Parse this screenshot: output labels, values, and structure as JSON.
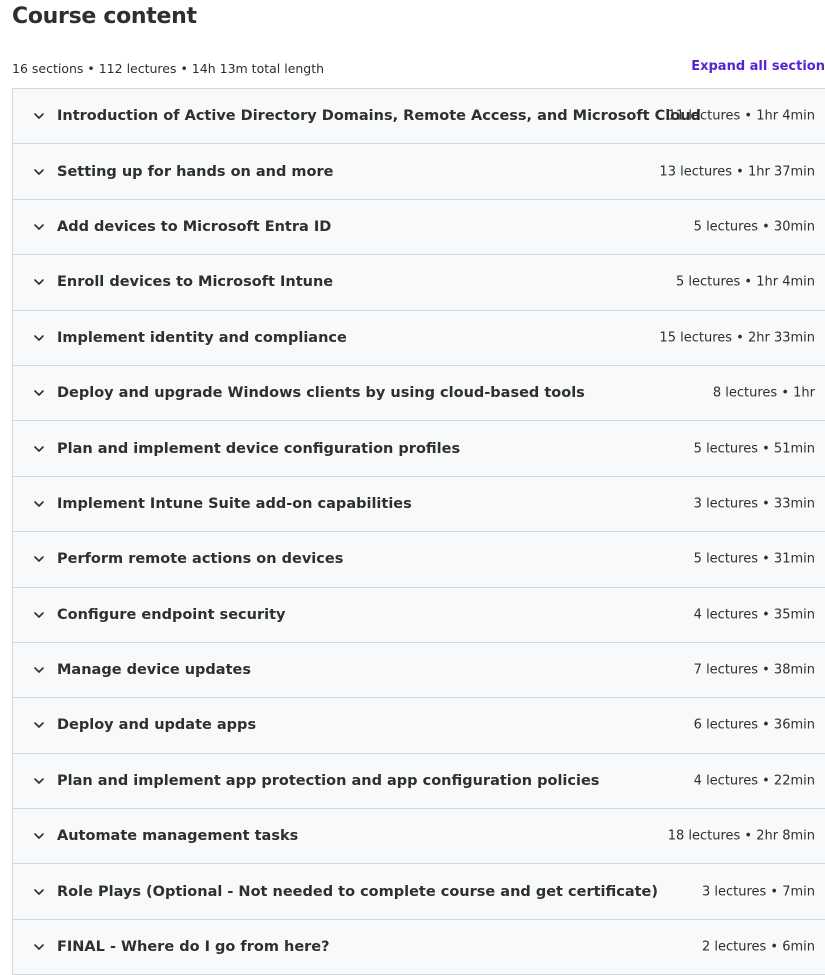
{
  "header": {
    "title": "Course content",
    "summary": "16 sections • 112 lectures • 14h 13m total length",
    "expand_all_label": "Expand all section"
  },
  "icons": {
    "section_toggle": "chevron-down-icon"
  },
  "colors": {
    "accent": "#5624d0",
    "section_bg": "#f7f9fa",
    "border": "#d1d7dc",
    "text": "#2d2f31"
  },
  "sections": [
    {
      "title": "Introduction of Active Directory Domains, Remote Access, and Microsoft Cloud",
      "meta": "11 lectures • 1hr 4min"
    },
    {
      "title": "Setting up for hands on and more",
      "meta": "13 lectures • 1hr 37min"
    },
    {
      "title": "Add devices to Microsoft Entra ID",
      "meta": "5 lectures • 30min"
    },
    {
      "title": "Enroll devices to Microsoft Intune",
      "meta": "5 lectures • 1hr 4min"
    },
    {
      "title": "Implement identity and compliance",
      "meta": "15 lectures • 2hr 33min"
    },
    {
      "title": "Deploy and upgrade Windows clients by using cloud-based tools",
      "meta": "8 lectures • 1hr"
    },
    {
      "title": "Plan and implement device configuration profiles",
      "meta": "5 lectures • 51min"
    },
    {
      "title": "Implement Intune Suite add-on capabilities",
      "meta": "3 lectures • 33min"
    },
    {
      "title": "Perform remote actions on devices",
      "meta": "5 lectures • 31min"
    },
    {
      "title": "Configure endpoint security",
      "meta": "4 lectures • 35min"
    },
    {
      "title": "Manage device updates",
      "meta": "7 lectures • 38min"
    },
    {
      "title": "Deploy and update apps",
      "meta": "6 lectures • 36min"
    },
    {
      "title": "Plan and implement app protection and app configuration policies",
      "meta": "4 lectures • 22min"
    },
    {
      "title": "Automate management tasks",
      "meta": "18 lectures • 2hr 8min"
    },
    {
      "title": "Role Plays (Optional - Not needed to complete course and get certificate)",
      "meta": "3 lectures • 7min"
    },
    {
      "title": "FINAL - Where do I go from here?",
      "meta": "2 lectures • 6min"
    }
  ]
}
